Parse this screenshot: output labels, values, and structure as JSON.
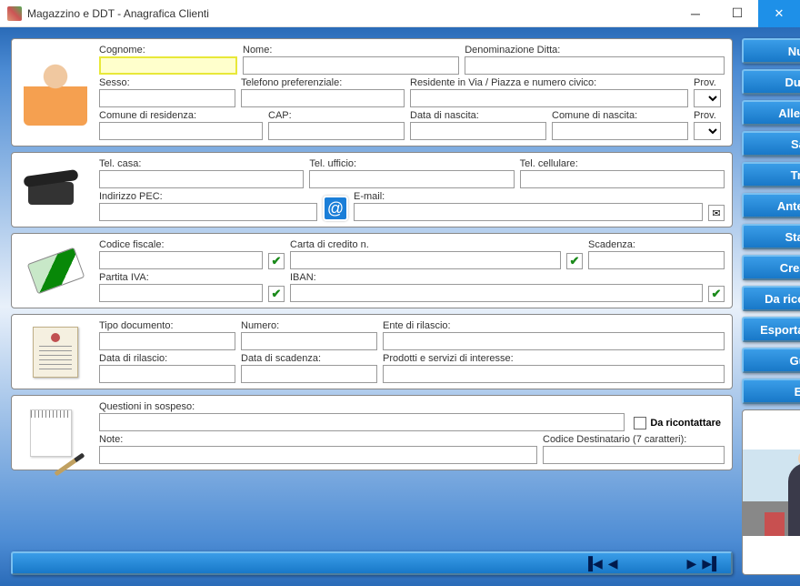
{
  "window": {
    "title": "Magazzino e DDT - Anagrafica Clienti"
  },
  "panel1": {
    "cognome": "Cognome:",
    "nome": "Nome:",
    "denom": "Denominazione Ditta:",
    "sesso": "Sesso:",
    "tel_pref": "Telefono preferenziale:",
    "residente": "Residente in Via / Piazza e numero civico:",
    "prov": "Prov.",
    "comune_res": "Comune di residenza:",
    "cap": "CAP:",
    "data_nasc": "Data di nascita:",
    "comune_nasc": "Comune di nascita:",
    "prov2": "Prov."
  },
  "panel2": {
    "tel_casa": "Tel. casa:",
    "tel_uff": "Tel. ufficio:",
    "tel_cell": "Tel. cellulare:",
    "pec": "Indirizzo PEC:",
    "email": "E-mail:"
  },
  "panel3": {
    "cf": "Codice fiscale:",
    "carta": "Carta di credito n.",
    "scad": "Scadenza:",
    "piva": "Partita IVA:",
    "iban": "IBAN:"
  },
  "panel4": {
    "tipo": "Tipo documento:",
    "numero": "Numero:",
    "ente": "Ente di rilascio:",
    "data_ril": "Data di rilascio:",
    "data_scad": "Data di scadenza:",
    "prodotti": "Prodotti e servizi di interesse:"
  },
  "panel5": {
    "questioni": "Questioni in sospeso:",
    "ricontattare": "Da ricontattare",
    "note": "Note:",
    "cod_dest": "Codice Destinatario (7 caratteri):"
  },
  "buttons": {
    "nuovo": "Nuovo",
    "duplica": "Duplica",
    "allega": "Allega file",
    "salva": "Salva",
    "trova": "Trova",
    "anteprima": "Anteprima",
    "stampa": "Stampa",
    "pdf": "Crea PDF",
    "ricont": "Da ricontattare",
    "esporta": "Esporta archivio",
    "guida": "Guida",
    "esci": "Esci"
  }
}
